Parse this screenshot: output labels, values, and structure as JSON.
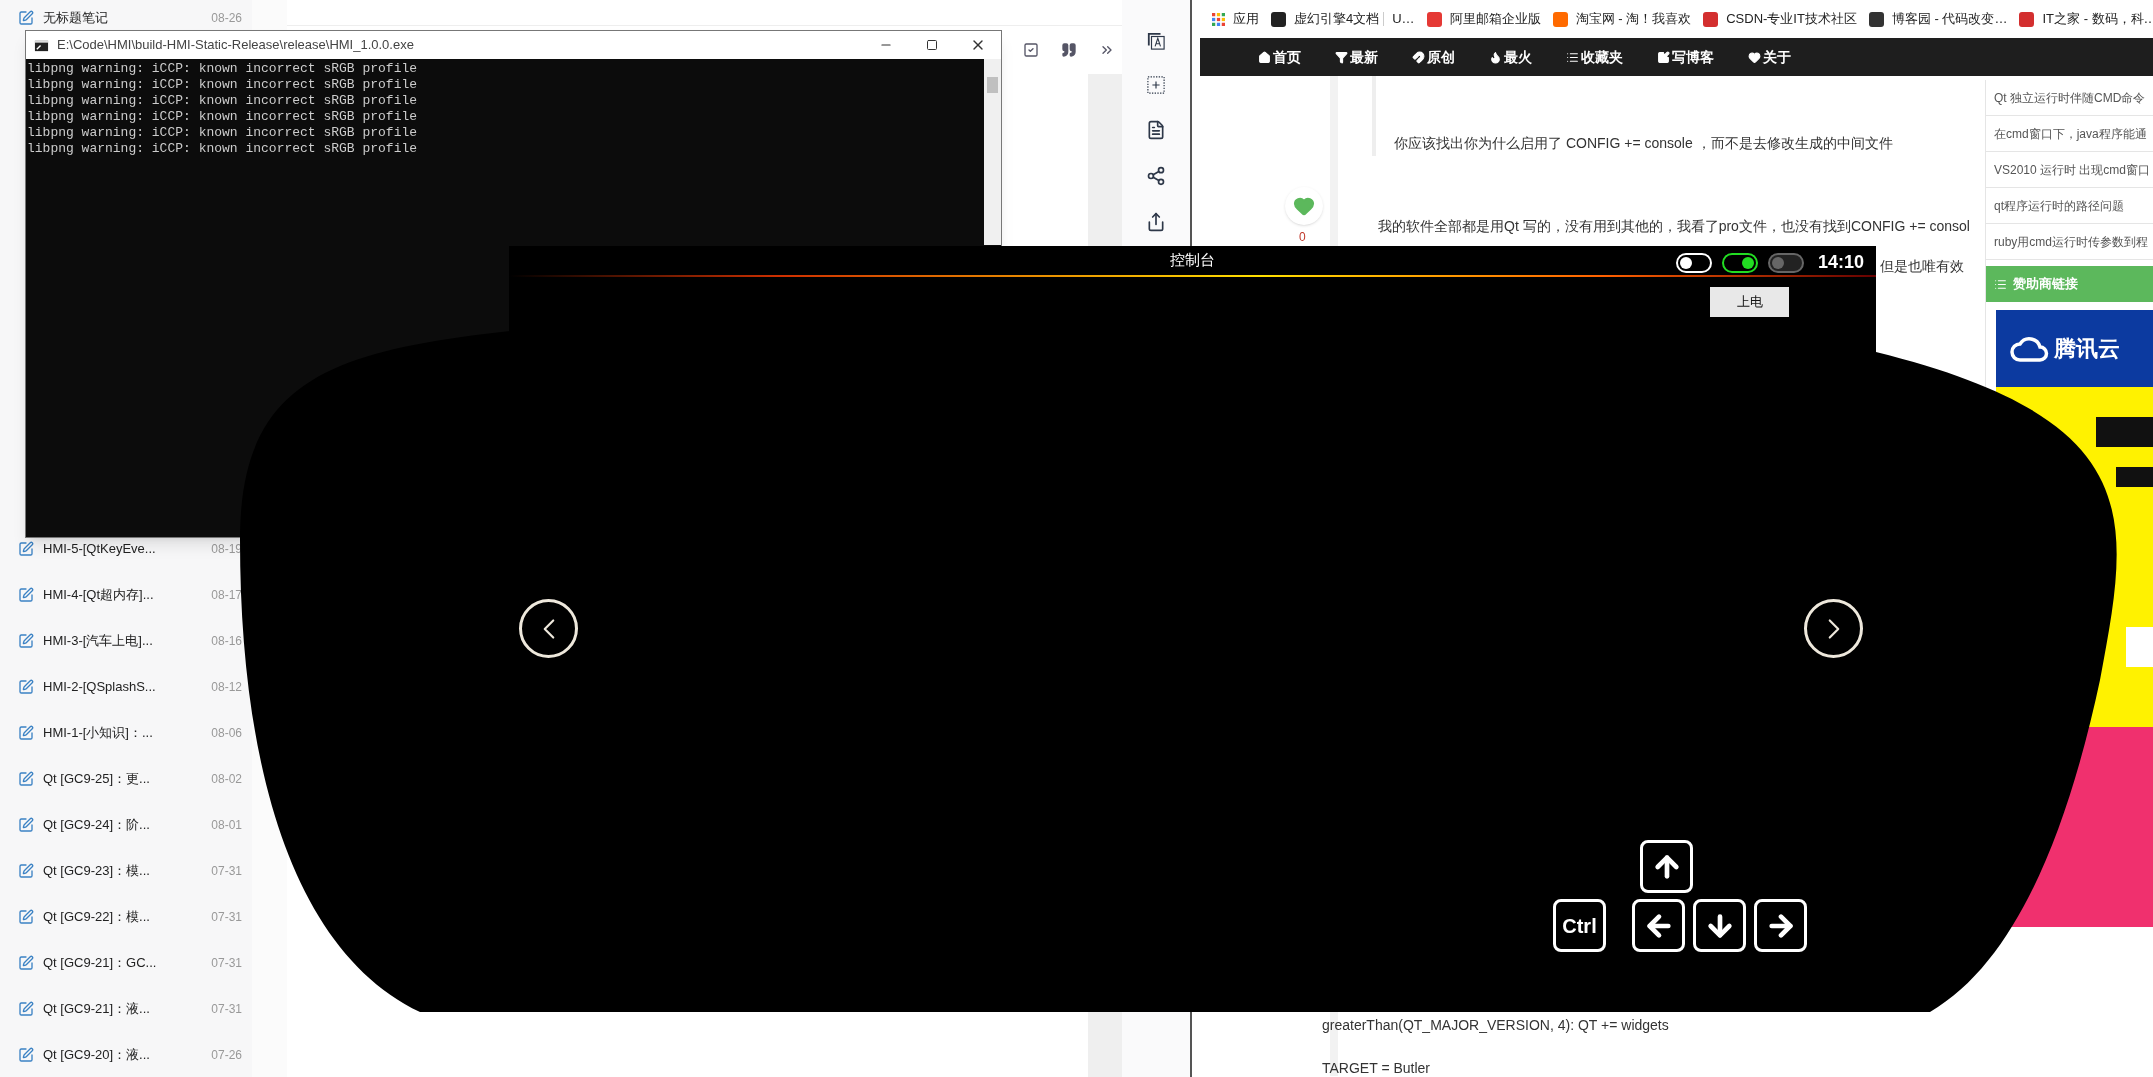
{
  "notes_app": {
    "note_list_top": [
      {
        "title": "无标题笔记",
        "date": "08-26"
      }
    ],
    "note_list": [
      {
        "title": "HMI-5-[QtKeyEve...",
        "date": "08-19"
      },
      {
        "title": "HMI-4-[Qt超内存]...",
        "date": "08-17"
      },
      {
        "title": "HMI-3-[汽车上电]...",
        "date": "08-16"
      },
      {
        "title": "HMI-2-[QSplashS...",
        "date": "08-12"
      },
      {
        "title": "HMI-1-[小知识]：...",
        "date": "08-06"
      },
      {
        "title": "Qt [GC9-25]：更...",
        "date": "08-02"
      },
      {
        "title": "Qt [GC9-24]：阶...",
        "date": "08-01"
      },
      {
        "title": "Qt [GC9-23]：模...",
        "date": "07-31"
      },
      {
        "title": "Qt [GC9-22]：模...",
        "date": "07-31"
      },
      {
        "title": "Qt [GC9-21]：GC...",
        "date": "07-31"
      },
      {
        "title": "Qt [GC9-21]：液...",
        "date": "07-31"
      },
      {
        "title": "Qt [GC9-20]：液...",
        "date": "07-26"
      }
    ]
  },
  "console": {
    "title": "E:\\Code\\HMI\\build-HMI-Static-Release\\release\\HMI_1.0.0.exe",
    "lines": [
      "libpng warning: iCCP: known incorrect sRGB profile",
      "libpng warning: iCCP: known incorrect sRGB profile",
      "libpng warning: iCCP: known incorrect sRGB profile",
      "libpng warning: iCCP: known incorrect sRGB profile",
      "libpng warning: iCCP: known incorrect sRGB profile",
      "libpng warning: iCCP: known incorrect sRGB profile"
    ]
  },
  "browser": {
    "bookmarks": [
      {
        "kind": "apps",
        "label": "应用"
      },
      {
        "kind": "site",
        "label": "虚幻引擎4文档"
      },
      {
        "kind": "divider",
        "label": "U…"
      },
      {
        "kind": "site",
        "label": "阿里邮箱企业版"
      },
      {
        "kind": "site",
        "label": "淘宝网 - 淘！我喜欢"
      },
      {
        "kind": "site",
        "label": "CSDN-专业IT技术社区"
      },
      {
        "kind": "site",
        "label": "博客园 - 代码改变…"
      },
      {
        "kind": "site",
        "label": "IT之家 - 数码，科…"
      }
    ],
    "nav": [
      {
        "kind": "home",
        "label": "首页"
      },
      {
        "kind": "filter",
        "label": "最新"
      },
      {
        "kind": "magnet",
        "label": "原创"
      },
      {
        "kind": "flame",
        "label": "最火"
      },
      {
        "kind": "list",
        "label": "收藏夹"
      },
      {
        "kind": "edit",
        "label": "写博客"
      },
      {
        "kind": "heart",
        "label": "关于"
      }
    ],
    "like_count": "0",
    "quote": "你应该找出你为什么启用了 CONFIG += console ，而不是去修改生成的中间文件",
    "paragraph": "我的软件全部都是用Qt 写的，没有用到其他的，我看了pro文件，也没有找到CONFIG += consol",
    "fragment": "但是也唯有效",
    "related": [
      "Qt 独立运行时伴随CMD命令",
      "在cmd窗口下，java程序能通",
      "VS2010 运行时 出现cmd窗口",
      "qt程序运行时的路径问题",
      "ruby用cmd运行时传参数到程"
    ],
    "sponsor_header": "赞助商链接",
    "ad_brand": "腾讯云",
    "code_lines": [
      "greaterThan(QT_MAJOR_VERSION, 4): QT += widgets",
      "TARGET = Butler"
    ]
  },
  "hmi": {
    "title": "控制台",
    "toggles": [
      {
        "on": false,
        "disabled": false
      },
      {
        "on": true,
        "disabled": false
      },
      {
        "on": false,
        "disabled": true
      }
    ],
    "time": "14:10",
    "power_button": "上电",
    "keys": [
      {
        "kind": "up"
      },
      {
        "kind": "ctrl",
        "label": "Ctrl"
      },
      {
        "kind": "left"
      },
      {
        "kind": "down"
      },
      {
        "kind": "right"
      }
    ]
  }
}
